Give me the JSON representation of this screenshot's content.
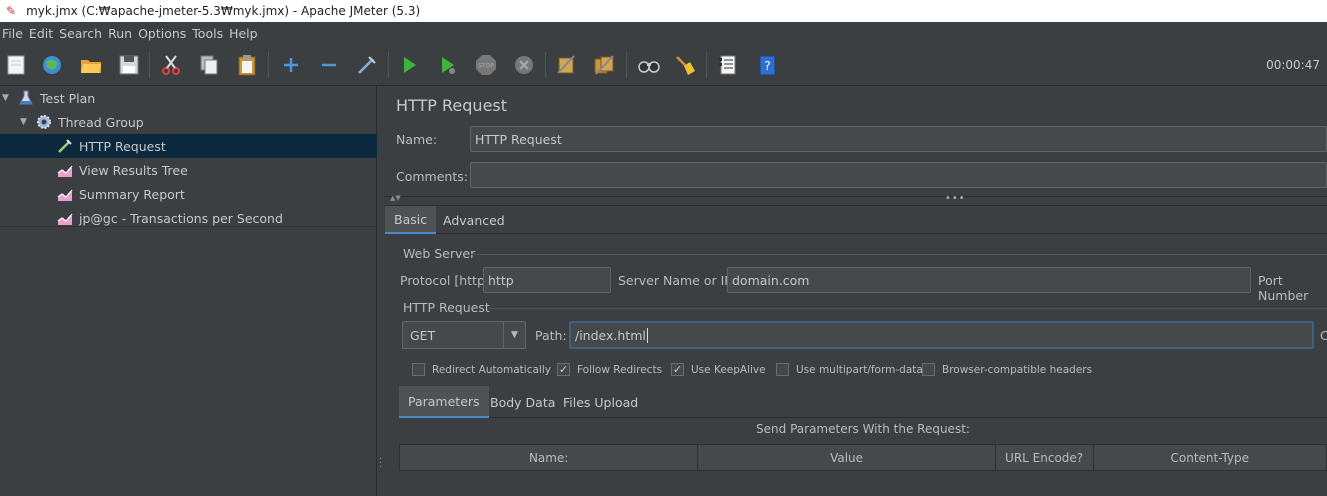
{
  "window": {
    "title": "myk.jmx (C:₩apache-jmeter-5.3₩myk.jmx) - Apache JMeter (5.3)"
  },
  "menu": [
    "File",
    "Edit",
    "Search",
    "Run",
    "Options",
    "Tools",
    "Help"
  ],
  "toolbar": {
    "buttons": [
      "new-icon",
      "templates-icon",
      "open-icon",
      "save-icon",
      "cut-icon",
      "copy-icon",
      "paste-icon",
      "expand-icon",
      "collapse-icon",
      "toggle-icon",
      "start-icon",
      "start-no-pause-icon",
      "stop-icon",
      "shutdown-icon",
      "clear-icon",
      "clear-all-icon",
      "search-icon",
      "reset-search-icon",
      "function-helper-icon",
      "help-icon"
    ],
    "timer": "00:00:47"
  },
  "tree": {
    "items": [
      {
        "label": "Test Plan",
        "icon": "test-plan-icon",
        "expanded": true,
        "level": 0
      },
      {
        "label": "Thread Group",
        "icon": "gear-icon",
        "expanded": true,
        "level": 1
      },
      {
        "label": "HTTP Request",
        "icon": "pipette-icon",
        "selected": true,
        "level": 2
      },
      {
        "label": "View Results Tree",
        "icon": "chart-icon",
        "level": 2
      },
      {
        "label": "Summary Report",
        "icon": "chart-icon",
        "level": 2
      },
      {
        "label": "jp@gc - Transactions per Second",
        "icon": "chart-icon",
        "level": 2
      }
    ]
  },
  "panel": {
    "title": "HTTP Request",
    "name_label": "Name:",
    "name_value": "HTTP Request",
    "comments_label": "Comments:",
    "comments_value": "",
    "tabs": [
      "Basic",
      "Advanced"
    ],
    "web_server": {
      "title": "Web Server",
      "protocol_label": "Protocol [http]:",
      "protocol_value": "http",
      "server_label": "Server Name or IP:",
      "server_value": "domain.com",
      "port_label": "Port Number"
    },
    "http_request": {
      "title": "HTTP Request",
      "method": "GET",
      "path_label": "Path:",
      "path_value": "/index.html",
      "trailing_label": "C"
    },
    "options": [
      {
        "label": "Redirect Automatically",
        "checked": false
      },
      {
        "label": "Follow Redirects",
        "checked": true
      },
      {
        "label": "Use KeepAlive",
        "checked": true
      },
      {
        "label": "Use multipart/form-data",
        "checked": false
      },
      {
        "label": "Browser-compatible headers",
        "checked": false
      }
    ],
    "subtabs": [
      "Parameters",
      "Body Data",
      "Files Upload"
    ],
    "table_caption": "Send Parameters With the Request:",
    "table_columns": [
      "Name:",
      "Value",
      "URL Encode?",
      "Content-Type"
    ]
  },
  "colors": {
    "background": "#3c3f41",
    "selection": "#0d293e",
    "accent": "#4a88c7"
  }
}
